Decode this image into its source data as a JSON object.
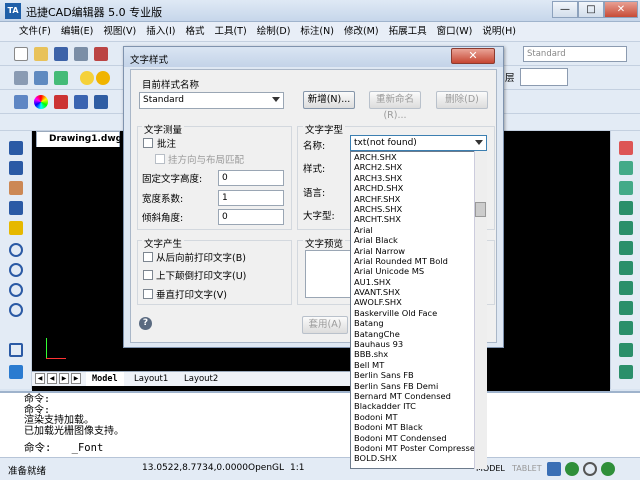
{
  "app": {
    "title": "迅捷CAD编辑器 5.0 专业版",
    "icon_text": "TA",
    "window_buttons": {
      "minimize": "—",
      "restore": "□",
      "close": "✕"
    }
  },
  "menubar": {
    "items": [
      "文件(F)",
      "编辑(E)",
      "视图(V)",
      "插入(I)",
      "格式",
      "工具(T)",
      "绘制(D)",
      "标注(N)",
      "修改(M)",
      "拓展工具",
      "窗口(W)",
      "说明(H)"
    ]
  },
  "toolbar": {
    "style_name": "Standard",
    "layer_label": "层"
  },
  "document": {
    "tab_name": "Drawing1.dwg",
    "layout_tabs": [
      "Model",
      "Layout1",
      "Layout2"
    ]
  },
  "command": {
    "history": [
      "命令:",
      "命令:",
      "渲染支持加载。",
      "已加载光栅图像支持。"
    ],
    "prompt": "命令:",
    "current_input": "_Font"
  },
  "statusbar": {
    "ready_text": "准备就绪",
    "coordinates": "13.0522,8.7734,0.0000",
    "render_mode": "OpenGL",
    "scale": "1:1",
    "model_label": "MODEL",
    "tablet_label": "TABLET"
  },
  "dialog": {
    "title": "文字样式",
    "close_label": "✕",
    "current_style_label": "目前样式名称",
    "current_style_value": "Standard",
    "new_button": "新增(N)...",
    "rename_button": "重新命名(R)...",
    "delete_button": "删除(D)",
    "measure_group": "文字测量",
    "annotative_label": "批注",
    "match_orientation_label": "挂方向与布局匹配",
    "fixed_height_label": "固定文字高度:",
    "fixed_height_value": "0",
    "width_factor_label": "宽度系数:",
    "width_factor_value": "1",
    "oblique_label": "倾斜角度:",
    "oblique_value": "0",
    "font_group": "文字字型",
    "name_label": "名称:",
    "name_value": "txt(not found)",
    "style_label": "样式:",
    "language_label": "语言:",
    "bigfont_label": "大字型:",
    "generate_group": "文字产生",
    "backwards_label": "从后向前打印文字(B)",
    "upside_down_label": "上下颠倒打印文字(U)",
    "vertical_label": "垂直打印文字(V)",
    "preview_label": "文字预览",
    "apply_button": "套用(A)",
    "help_icon_text": "?"
  },
  "font_list": [
    "ARCH.SHX",
    "ARCH2.SHX",
    "ARCH3.SHX",
    "ARCHD.SHX",
    "ARCHF.SHX",
    "ARCHS.SHX",
    "ARCHT.SHX",
    "Arial",
    "Arial Black",
    "Arial Narrow",
    "Arial Rounded MT Bold",
    "Arial Unicode MS",
    "AU1.SHX",
    "AVANT.SHX",
    "AWOLF.SHX",
    "Baskerville Old Face",
    "Batang",
    "BatangChe",
    "Bauhaus 93",
    "BBB.shx",
    "Bell MT",
    "Berlin Sans FB",
    "Berlin Sans FB Demi",
    "Bernard MT Condensed",
    "Blackadder ITC",
    "Bodoni MT",
    "Bodoni MT Black",
    "Bodoni MT Condensed",
    "Bodoni MT Poster Compressed",
    "BOLD.SHX"
  ]
}
